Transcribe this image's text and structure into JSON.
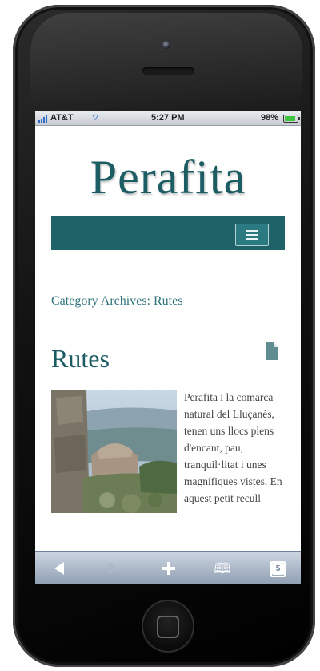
{
  "status_bar": {
    "carrier": "AT&T",
    "time": "5:27 PM",
    "battery": "98%",
    "battery_level": 0.98,
    "wifi_icon": "wifi-icon",
    "signal_icon": "signal-icon"
  },
  "site": {
    "title": "Perafita",
    "accent_color": "#1f6268",
    "menu_icon": "menu-icon"
  },
  "archive": {
    "title": "Category Archives: Rutes"
  },
  "post": {
    "title": "Rutes",
    "format_icon": "document-icon",
    "excerpt": "Perafita i la comarca natural del Lluçanès, tenen uns llocs plens d'encant, pau, tranquil·litat i unes magnífiques vistes. En aquest petit recull"
  },
  "toolbar": {
    "back_icon": "back-arrow-icon",
    "forward_icon": "forward-arrow-icon",
    "add_icon": "plus-icon",
    "bookmarks_icon": "bookmarks-icon",
    "pages_icon": "pages-icon",
    "pages_count": "5"
  }
}
